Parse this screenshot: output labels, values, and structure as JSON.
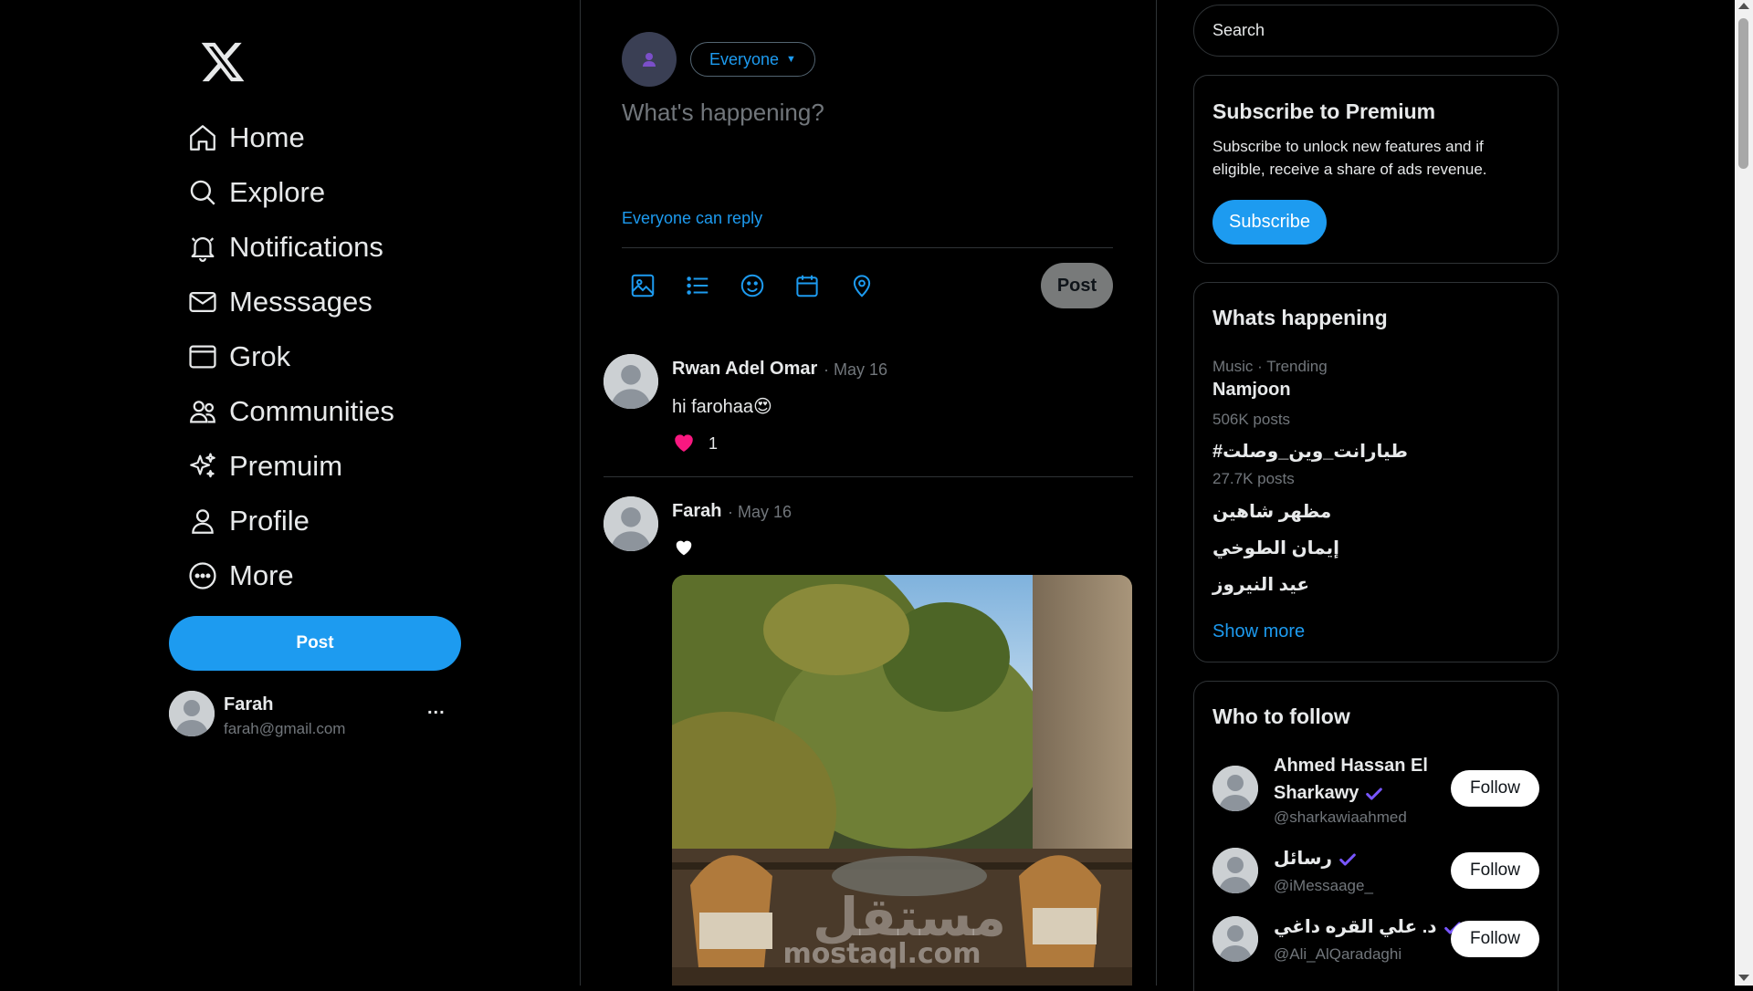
{
  "theme": {
    "background": "#000000",
    "accent": "#1d9bf0",
    "text": "#e7e9ea",
    "muted": "#71767b",
    "border": "#2f3336",
    "like_color": "#f91880",
    "verified_color": "#7856ff"
  },
  "sidebar": {
    "logo_icon": "x-logo-icon",
    "items": [
      {
        "label": "Home",
        "icon": "home-icon"
      },
      {
        "label": "Explore",
        "icon": "search-icon"
      },
      {
        "label": "Notifications",
        "icon": "bell-icon"
      },
      {
        "label": "Messsages",
        "icon": "envelope-icon"
      },
      {
        "label": "Grok",
        "icon": "grok-icon"
      },
      {
        "label": "Communities",
        "icon": "communities-icon"
      },
      {
        "label": "Premuim",
        "icon": "sparkle-icon"
      },
      {
        "label": "Profile",
        "icon": "person-icon"
      },
      {
        "label": "More",
        "icon": "more-circle-icon"
      }
    ],
    "post_label": "Post",
    "account": {
      "name": "Farah",
      "email": "farah@gmail.com",
      "menu_label": "..."
    }
  },
  "composer": {
    "audience_label": "Everyone",
    "placeholder": "What's happening?",
    "reply_setting": "Everyone can reply",
    "tools": [
      "image-icon",
      "list-icon",
      "emoji-icon",
      "calendar-icon",
      "location-icon"
    ],
    "post_label": "Post"
  },
  "feed": [
    {
      "name": "Rwan Adel Omar",
      "date": "· May 16",
      "text": "hi farohaa😍",
      "likes": "1",
      "liked": true
    },
    {
      "name": "Farah",
      "date": "· May 16",
      "text": "",
      "liked": false,
      "has_image": true
    }
  ],
  "right": {
    "search_placeholder": "Search",
    "premium": {
      "title": "Subscribe to Premium",
      "description": "Subscribe to unlock new features and if eligible, receive a share of ads revenue.",
      "button": "Subscribe"
    },
    "trends": {
      "title": "Whats happening",
      "items": [
        {
          "meta": "Music · Trending",
          "topic": "Namjoon",
          "count": "506K posts"
        },
        {
          "topic": "#طيارانت_وين_وصلت",
          "count": "27.7K posts"
        },
        {
          "topic": "مظهر شاهين"
        },
        {
          "topic": "إيمان الطوخي"
        },
        {
          "topic": "عيد النيروز"
        }
      ],
      "show_more": "Show more"
    },
    "who_to_follow": {
      "title": "Who to follow",
      "items": [
        {
          "name_line1": "Ahmed Hassan El",
          "name_line2": "Sharkawy",
          "handle": "@sharkawiaahmed",
          "button": "Follow"
        },
        {
          "name": "رسائل",
          "handle": "@iMessaage_",
          "button": "Follow"
        },
        {
          "name": "د. علي القره داغي",
          "handle": "@Ali_AlQaradaghi",
          "button": "Follow"
        }
      ]
    }
  },
  "watermark": {
    "arabic": "مستقل",
    "latin": "mostaql.com"
  }
}
